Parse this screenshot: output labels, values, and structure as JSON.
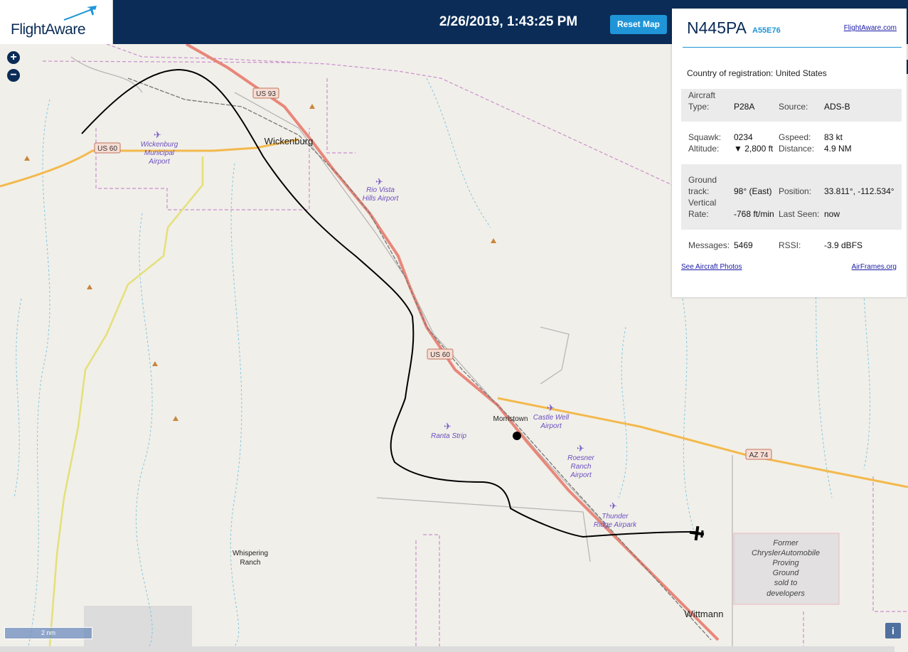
{
  "header": {
    "logo_text": "FlightAware",
    "timestamp": "2/26/2019, 1:43:25 PM",
    "reset_label": "Reset Map"
  },
  "panel": {
    "ident": "N445PA",
    "hex": "A55E76",
    "fa_link": "FlightAware.com",
    "country_label": "Country of registration:",
    "country_value": "United States",
    "aircraft_type_label": "Aircraft Type:",
    "aircraft_type_value": "P28A",
    "source_label": "Source:",
    "source_value": "ADS-B",
    "squawk_label": "Squawk:",
    "squawk_value": "0234",
    "gspeed_label": "Gspeed:",
    "gspeed_value": "83 kt",
    "altitude_label": "Altitude:",
    "altitude_value": "▼ 2,800 ft",
    "distance_label": "Distance:",
    "distance_value": "4.9 NM",
    "ground_track_label": "Ground track:",
    "ground_track_value": "98° (East)",
    "position_label": "Position:",
    "position_value": "33.811°, -112.534°",
    "vertical_rate_label": "Vertical Rate:",
    "vertical_rate_value": "-768 ft/min",
    "last_seen_label": "Last Seen:",
    "last_seen_value": "now",
    "messages_label": "Messages:",
    "messages_value": "5469",
    "rssi_label": "RSSI:",
    "rssi_value": "-3.9 dBFS",
    "photos_link": "See Aircraft Photos",
    "airframes_link": "AirFrames.org"
  },
  "map": {
    "towns": {
      "wickenburg": "Wickenburg",
      "morristown": "Morristown",
      "wittmann": "Wittmann"
    },
    "place_whispering_1": "Whispering",
    "place_whispering_2": "Ranch",
    "highways": {
      "us93": "US 93",
      "us60_west": "US 60",
      "us60_south": "US 60",
      "az74": "AZ 74"
    },
    "airports": {
      "wickenburg_1": "Wickenburg",
      "wickenburg_2": "Municipal",
      "wickenburg_3": "Airport",
      "riovista_1": "Rio Vista",
      "riovista_2": "Hills Airport",
      "castlewell_1": "Castle Well",
      "castlewell_2": "Airport",
      "ranta": "Ranta Strip",
      "roesner_1": "Roesner",
      "roesner_2": "Ranch",
      "roesner_3": "Airport",
      "thunder_1": "Thunder",
      "thunder_2": "Ridge Airpark"
    },
    "proving_ground": [
      "Former",
      "ChryslerAutomobile",
      "Proving",
      "Ground",
      "sold to",
      "developers"
    ],
    "scale_label": "2 nm",
    "zoom_in": "+",
    "zoom_out": "−",
    "info": "i",
    "colors": {
      "track": "#000000",
      "highway": "#e8877a",
      "az74": "#f3b94d",
      "boundary": "#c98fd0",
      "water": "#7fc7e6",
      "airport": "#7a5ec8"
    }
  }
}
